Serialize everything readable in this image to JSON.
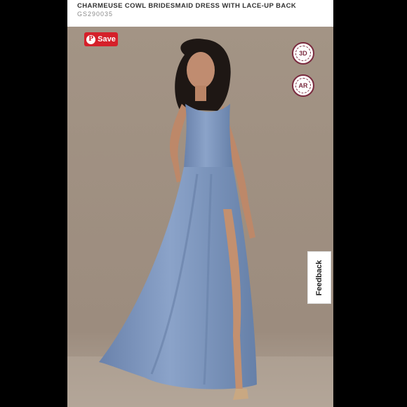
{
  "product": {
    "title": "CHARMEUSE COWL BRIDESMAID DRESS WITH LACE-UP BACK",
    "sku": "GS290035"
  },
  "pin_button": {
    "label": "Save",
    "icon": "pinterest-icon",
    "color": "#d5202a"
  },
  "view_buttons": [
    {
      "label": "3D",
      "icon": "3d-view-icon"
    },
    {
      "label": "AR",
      "icon": "ar-view-icon"
    }
  ],
  "feedback_tab": {
    "label": "Feedback"
  },
  "colors": {
    "accent": "#7b2b3f",
    "dress": "#7790b8",
    "backdrop": "#a09183"
  }
}
